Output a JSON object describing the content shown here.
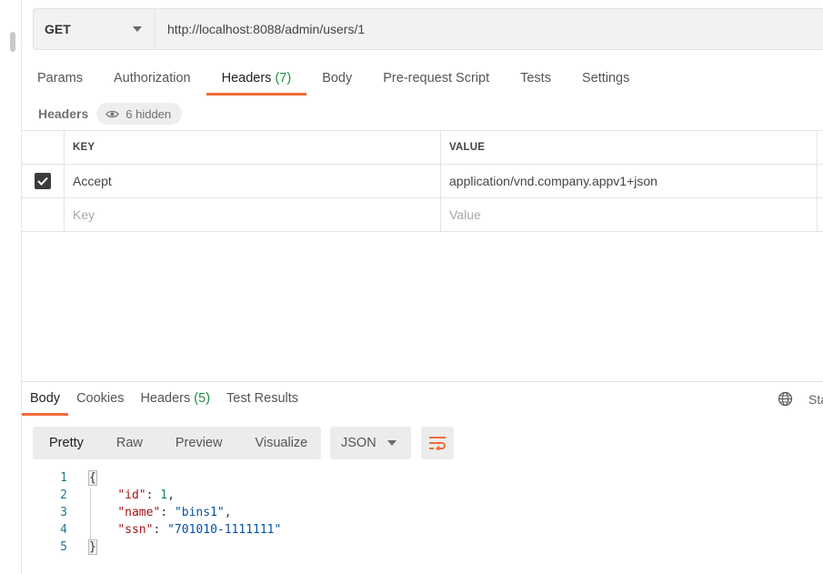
{
  "request": {
    "method": "GET",
    "url": "http://localhost:8088/admin/users/1"
  },
  "request_tabs": [
    {
      "label": "Params",
      "count": ""
    },
    {
      "label": "Authorization",
      "count": ""
    },
    {
      "label": "Headers",
      "count": "(7)",
      "active": true
    },
    {
      "label": "Body",
      "count": ""
    },
    {
      "label": "Pre-request Script",
      "count": ""
    },
    {
      "label": "Tests",
      "count": ""
    },
    {
      "label": "Settings",
      "count": ""
    }
  ],
  "headers_bar": {
    "title": "Headers",
    "hidden_label": "6 hidden"
  },
  "headers_table": {
    "columns": {
      "key": "KEY",
      "value": "VALUE"
    },
    "rows": [
      {
        "checked": true,
        "key": "Accept",
        "value": "application/vnd.company.appv1+json"
      }
    ],
    "new_row": {
      "key_placeholder": "Key",
      "value_placeholder": "Value"
    }
  },
  "response_tabs": [
    {
      "label": "Body",
      "count": "",
      "active": true
    },
    {
      "label": "Cookies",
      "count": ""
    },
    {
      "label": "Headers",
      "count": "(5)"
    },
    {
      "label": "Test Results",
      "count": ""
    }
  ],
  "status_text": "Sta",
  "response_view": {
    "modes": [
      "Pretty",
      "Raw",
      "Preview",
      "Visualize"
    ],
    "active_mode": "Pretty",
    "format": "JSON"
  },
  "response_body": {
    "line_numbers": [
      "1",
      "2",
      "3",
      "4",
      "5"
    ],
    "open_brace": "{",
    "close_brace": "}",
    "fields": [
      {
        "key": "\"id\"",
        "value": "1",
        "type": "number",
        "trail": ","
      },
      {
        "key": "\"name\"",
        "value": "\"bins1\"",
        "type": "string",
        "trail": ","
      },
      {
        "key": "\"ssn\"",
        "value": "\"701010-1111111\"",
        "type": "string",
        "trail": ""
      }
    ]
  },
  "colors": {
    "accent": "#f26b3a",
    "count_green": "#1e8e3e",
    "json_key": "#a31515",
    "json_number": "#098658",
    "json_string": "#0451a5",
    "line_number": "#237893"
  },
  "icons": {
    "method_caret": "chevron-down-icon",
    "hidden": "eye-icon",
    "checkbox": "checkmark-icon",
    "globe": "globe-icon",
    "format_caret": "chevron-down-icon",
    "wrap": "wrap-lines-icon"
  }
}
